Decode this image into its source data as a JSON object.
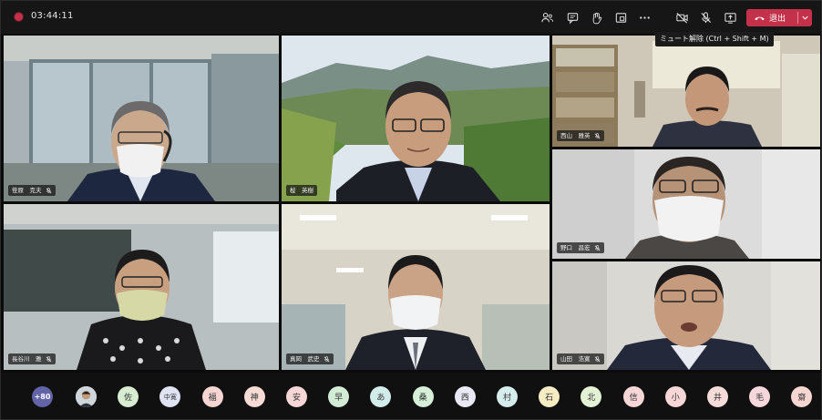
{
  "meeting": {
    "elapsed_time": "03:44:11",
    "tooltip": "ミュート解除 (Ctrl + Shift + M)",
    "leave_label": "退出",
    "recording_color": "#c4314b"
  },
  "toolbar": {
    "icons": [
      "participants-icon",
      "chat-icon",
      "raise-hand-icon",
      "share-tray-icon",
      "more-options-icon",
      "camera-off-icon",
      "mic-muted-icon",
      "share-screen-icon"
    ]
  },
  "participants": [
    {
      "name": "笹原　克夫"
    },
    {
      "name": "桜　英樹"
    },
    {
      "name": "西山　雅英"
    },
    {
      "name": "野口　昌宏"
    },
    {
      "name": "長谷川　雅"
    },
    {
      "name": "真岡　武史"
    },
    {
      "name": "山田　浩寛"
    }
  ],
  "roster": {
    "overflow": "+80",
    "avatars": [
      {
        "initials": "",
        "color": "#ffffff",
        "photo": true
      },
      {
        "initials": "佐",
        "color": "#d8ecd2"
      },
      {
        "initials": "中寛",
        "color": "#dfe3f2"
      },
      {
        "initials": "福",
        "color": "#f6d5d2"
      },
      {
        "initials": "神",
        "color": "#f7dcd6"
      },
      {
        "initials": "安",
        "color": "#f6d6d6"
      },
      {
        "initials": "早",
        "color": "#d3ecd6"
      },
      {
        "initials": "あ",
        "color": "#d2ecea"
      },
      {
        "initials": "桑",
        "color": "#d6efd9"
      },
      {
        "initials": "西",
        "color": "#e9e9f5"
      },
      {
        "initials": "村",
        "color": "#d6ecec"
      },
      {
        "initials": "石",
        "color": "#f5ecc4"
      },
      {
        "initials": "北",
        "color": "#e3f1d4"
      },
      {
        "initials": "信",
        "color": "#f6d6d6"
      },
      {
        "initials": "小",
        "color": "#f6d6d6"
      },
      {
        "initials": "井",
        "color": "#f6dcd8"
      },
      {
        "initials": "毛",
        "color": "#f6d8dc"
      },
      {
        "initials": "齋",
        "color": "#f6d6d0"
      }
    ]
  }
}
